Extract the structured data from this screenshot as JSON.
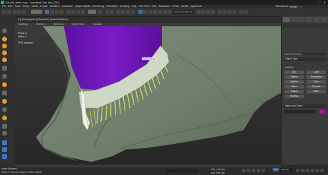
{
  "app": {
    "title": "ArtA35_ferric.max - Autodesk 3ds Max 2023"
  },
  "menu": {
    "items": [
      "File",
      "Edit",
      "Tools",
      "Group",
      "Views",
      "Create",
      "Modifiers",
      "Animation",
      "Graph Editors",
      "Rendering",
      "Customize",
      "Scripting",
      "Help",
      "Civil View",
      "GoZ",
      "Substance",
      "V-Ray",
      "Arnold",
      "rapidTools"
    ],
    "workspaces_label": "Workspaces:",
    "workspace_value": "Default"
  },
  "toolbar": {
    "selection_set": "Create Selection Set"
  },
  "ribbon": {
    "tabs": [
      "Modeling",
      "Freeform",
      "Selection",
      "Object Paint",
      "Populate"
    ]
  },
  "viewport": {
    "label": "[+] [Orthographic ] [Standard ] [Default Shading ]",
    "stats": {
      "polys": "Polys:  0",
      "verts": "Verts:  0"
    },
    "fps": "FPS:     Inactive",
    "object_tag": "Cloth_Ppml1",
    "cloth_color": "#6f7e6b",
    "body_color": "#6a14b0"
  },
  "command_panel": {
    "category": "Standard Primitives",
    "object_type_title": "Object Type",
    "autogrid": "AutoGrid",
    "buttons": [
      "Box",
      "Cone",
      "Sphere",
      "GeoSphere",
      "Cylinder",
      "Tube",
      "Torus",
      "Pyramid",
      "Teapot",
      "Plane",
      "TextPlus"
    ],
    "name_color_title": "Name and Color",
    "object_color": "#b30fb3"
  },
  "status": {
    "line1": "None Selected",
    "line2": "Click or click-and-drag to select objects",
    "grid": "Grid = 10,0cm",
    "time_tag": "Add Time Tag",
    "auto_key": "Auto",
    "selected": "Selected"
  }
}
